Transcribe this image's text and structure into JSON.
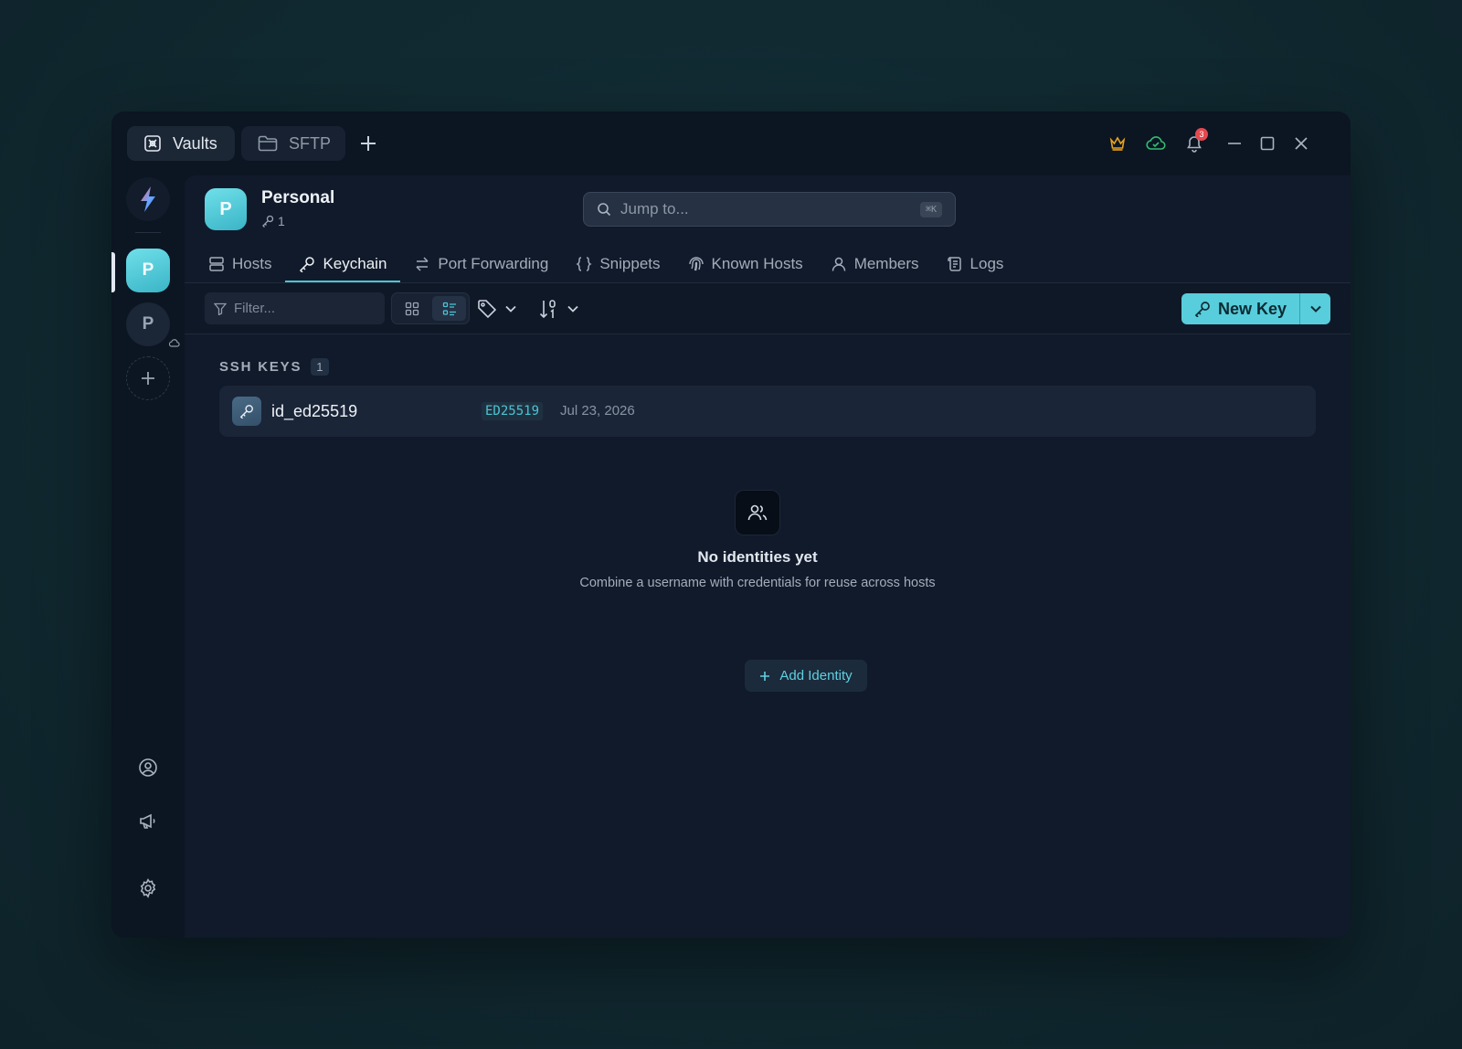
{
  "titlebar": {
    "tabs": [
      {
        "label": "Vaults",
        "icon": "vault-icon"
      },
      {
        "label": "SFTP",
        "icon": "folder-icon"
      }
    ],
    "notifications_count": "3"
  },
  "rail": {
    "vaults": [
      {
        "letter": "P",
        "active": true
      },
      {
        "letter": "P",
        "active": false
      }
    ]
  },
  "vault": {
    "avatar_letter": "P",
    "name": "Personal",
    "key_count": "1"
  },
  "search": {
    "placeholder": "Jump to...",
    "shortcut": "⌘K"
  },
  "nav": {
    "tabs": [
      {
        "label": "Hosts",
        "icon": "hosts-icon"
      },
      {
        "label": "Keychain",
        "icon": "key-icon",
        "active": true
      },
      {
        "label": "Port Forwarding",
        "icon": "arrows-icon"
      },
      {
        "label": "Snippets",
        "icon": "braces-icon"
      },
      {
        "label": "Known Hosts",
        "icon": "fingerprint-icon"
      },
      {
        "label": "Members",
        "icon": "user-icon"
      },
      {
        "label": "Logs",
        "icon": "scroll-icon"
      }
    ]
  },
  "toolbar": {
    "filter_placeholder": "Filter...",
    "new_key_label": "New Key"
  },
  "ssh_keys": {
    "section_label": "SSH KEYS",
    "count": "1",
    "items": [
      {
        "name": "id_ed25519",
        "type": "ED25519",
        "date": "Jul 23, 2026"
      }
    ]
  },
  "identities": {
    "empty_title": "No identities yet",
    "empty_desc": "Combine a username with credentials for reuse across hosts",
    "add_label": "Add Identity"
  },
  "colors": {
    "accent": "#4cc4d4",
    "window_bg": "#0c1522",
    "main_bg": "#111a2a",
    "notification": "#e5484d",
    "crown": "#e8a31e",
    "sync": "#2fbf71"
  }
}
